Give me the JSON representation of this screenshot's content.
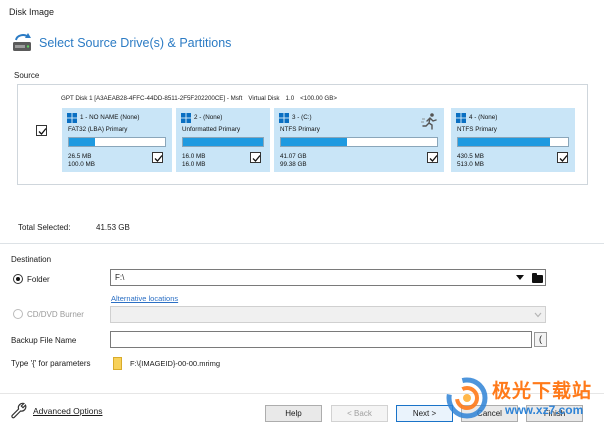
{
  "window": {
    "title": "Disk Image"
  },
  "header": {
    "title": "Select Source Drive(s) & Partitions",
    "icon": "disk-refresh-icon"
  },
  "source": {
    "label": "Source",
    "disk": {
      "selected": true,
      "name": "GPT Disk 1 [A3AEAB28-4FFC-44DD-8511-2F5F202200CE] - Msft",
      "type": "Virtual Disk",
      "size": "1.0",
      "size_detail": "<100.00 GB>"
    },
    "partitions": [
      {
        "title": "1 - NO NAME (None)",
        "filesystem": "FAT32 (LBA) Primary",
        "used": "26.5 MB",
        "total": "100.0 MB",
        "fill_fraction": 0.27,
        "checked": true
      },
      {
        "title": "2 - (None)",
        "filesystem": "Unformatted Primary",
        "used": "16.0 MB",
        "total": "16.0 MB",
        "fill_fraction": 1.0,
        "checked": true
      },
      {
        "title": "3 - (C:)",
        "filesystem": "NTFS Primary",
        "used": "41.07 GB",
        "total": "99.38 GB",
        "fill_fraction": 0.42,
        "checked": true
      },
      {
        "title": "4 - (None)",
        "filesystem": "NTFS Primary",
        "used": "430.5 MB",
        "total": "513.0 MB",
        "fill_fraction": 0.84,
        "checked": true
      }
    ]
  },
  "total_selected": {
    "label": "Total Selected:",
    "value": "41.53 GB"
  },
  "destination": {
    "label": "Destination",
    "folder_option": {
      "label": "Folder",
      "selected": true,
      "value": "F:\\"
    },
    "alternative_locations": "Alternative locations",
    "cd_option": {
      "label": "CD/DVD Burner",
      "selected": false,
      "value": ""
    },
    "backup_file_name": {
      "label": "Backup File Name",
      "value": ""
    },
    "parameter_hint": "Type '{' for parameters",
    "name_pattern": "F:\\{IMAGEID}-00-00.mrimg"
  },
  "footer": {
    "advanced_options": "Advanced Options",
    "help": "Help",
    "back": "< Back",
    "next": "Next >",
    "cancel": "Cancel",
    "finish": "Finish"
  },
  "watermark": {
    "text": "极光下载站",
    "url": "www.xz7.com"
  },
  "colors": {
    "accent": "#2b7bc4",
    "partition_bg": "#c9e5f7",
    "bar_fill": "#1f9ae0"
  }
}
